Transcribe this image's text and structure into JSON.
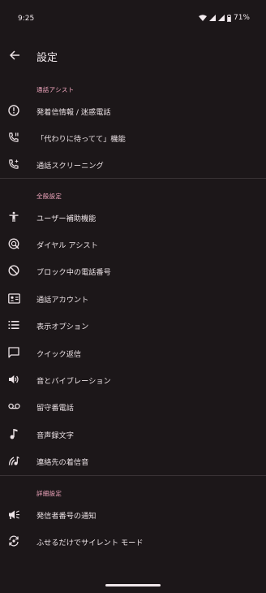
{
  "status_bar": {
    "time": "9:25",
    "battery": "71%"
  },
  "app_bar": {
    "title": "設定"
  },
  "sections": [
    {
      "header": "通話アシスト",
      "items": [
        {
          "label": "発着信情報 / 迷惑電話",
          "icon": "info-circle-icon"
        },
        {
          "label": "「代わりに待ってて」機能",
          "icon": "phone-hold-icon"
        },
        {
          "label": "通話スクリーニング",
          "icon": "phone-screening-icon"
        }
      ]
    },
    {
      "header": "全般設定",
      "items": [
        {
          "label": "ユーザー補助機能",
          "icon": "accessibility-icon"
        },
        {
          "label": "ダイヤル アシスト",
          "icon": "dial-assist-icon"
        },
        {
          "label": "ブロック中の電話番号",
          "icon": "block-icon"
        },
        {
          "label": "通話アカウント",
          "icon": "contact-card-icon"
        },
        {
          "label": "表示オプション",
          "icon": "list-icon"
        },
        {
          "label": "クイック返信",
          "icon": "message-icon"
        },
        {
          "label": "音とバイブレーション",
          "icon": "volume-icon"
        },
        {
          "label": "留守番電話",
          "icon": "voicemail-icon"
        },
        {
          "label": "音声録文字",
          "icon": "music-note-icon"
        },
        {
          "label": "連絡先の着信音",
          "icon": "ringtone-icon"
        }
      ]
    },
    {
      "header": "詳細設定",
      "items": [
        {
          "label": "発信者番号の通知",
          "icon": "megaphone-icon"
        },
        {
          "label": "ふせるだけでサイレント モード",
          "icon": "flip-silence-icon"
        }
      ]
    }
  ],
  "colors": {
    "background": "#1c1719",
    "accent": "#f2a7bf",
    "text": "#ece3e6",
    "divider": "#3a3336"
  }
}
